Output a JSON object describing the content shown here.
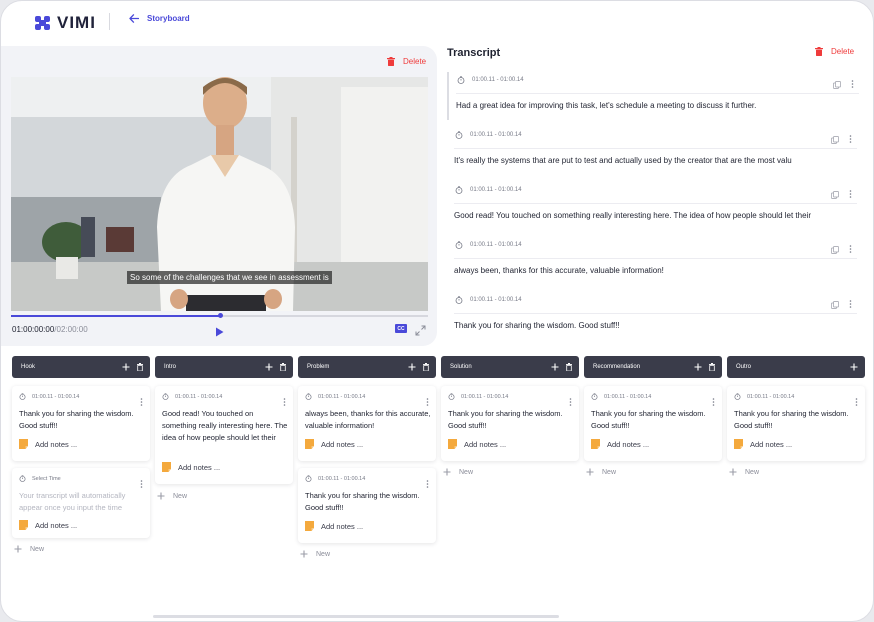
{
  "app": {
    "logo": "VIMI",
    "back_label": "Storyboard"
  },
  "colors": {
    "accent": "#4a49d9",
    "danger": "#ef3b3b",
    "column_header": "#3a3c4a"
  },
  "video": {
    "delete_label": "Delete",
    "subtitle": "So some of the challenges that we see in assessment is",
    "current_time": "01:00:00:00",
    "separator": "/",
    "duration": "02:00:00",
    "progress": 0.5,
    "cc_label": "CC"
  },
  "transcript": {
    "title": "Transcript",
    "delete_label": "Delete",
    "entries": [
      {
        "time": "01:00.11 - 01:00.14",
        "text": "Had a great idea for improving this task, let's schedule a meeting to discuss it further."
      },
      {
        "time": "01:00.11 - 01:00.14",
        "text": "It's really the systems that are put to test and actually used by the creator that are the most valu"
      },
      {
        "time": "01:00.11 - 01:00.14",
        "text": "Good read! You touched on something really interesting here. The idea of how people should let their"
      },
      {
        "time": "01:00.11 - 01:00.14",
        "text": "always been, thanks for this accurate, valuable information!"
      },
      {
        "time": "01:00.11 - 01:00.14",
        "text": "Thank you for sharing the wisdom. Good stuff!!"
      }
    ]
  },
  "board": {
    "notes_label": "Add notes ...",
    "new_label": "New",
    "columns": [
      {
        "title": "Hook",
        "cards": [
          {
            "time": "01:00.11 - 01:00.14",
            "text": "Thank you for sharing the wisdom. Good stuff!!"
          },
          {
            "time": "Select Time",
            "text": "Your transcript will automatically appear once you input the time"
          }
        ]
      },
      {
        "title": "Intro",
        "cards": [
          {
            "time": "01:00.11 - 01:00.14",
            "text": "Good read! You touched on something really interesting here. The idea of how people should let their"
          }
        ]
      },
      {
        "title": "Problem",
        "cards": [
          {
            "time": "01:00.11 - 01:00.14",
            "text": "always been, thanks for this accurate, valuable information!"
          },
          {
            "time": "01:00.11 - 01:00.14",
            "text": "Thank you for sharing the wisdom. Good stuff!!"
          }
        ]
      },
      {
        "title": "Solution",
        "cards": [
          {
            "time": "01:00.11 - 01:00.14",
            "text": "Thank you for sharing the wisdom. Good stuff!!"
          }
        ]
      },
      {
        "title": "Recommendation",
        "cards": [
          {
            "time": "01:00.11 - 01:00.14",
            "text": "Thank you for sharing the wisdom. Good stuff!!"
          }
        ]
      },
      {
        "title": "Outro",
        "cards": [
          {
            "time": "01:00.11 - 01:00.14",
            "text": "Thank you for sharing the wisdom. Good stuff!!"
          }
        ]
      }
    ]
  }
}
